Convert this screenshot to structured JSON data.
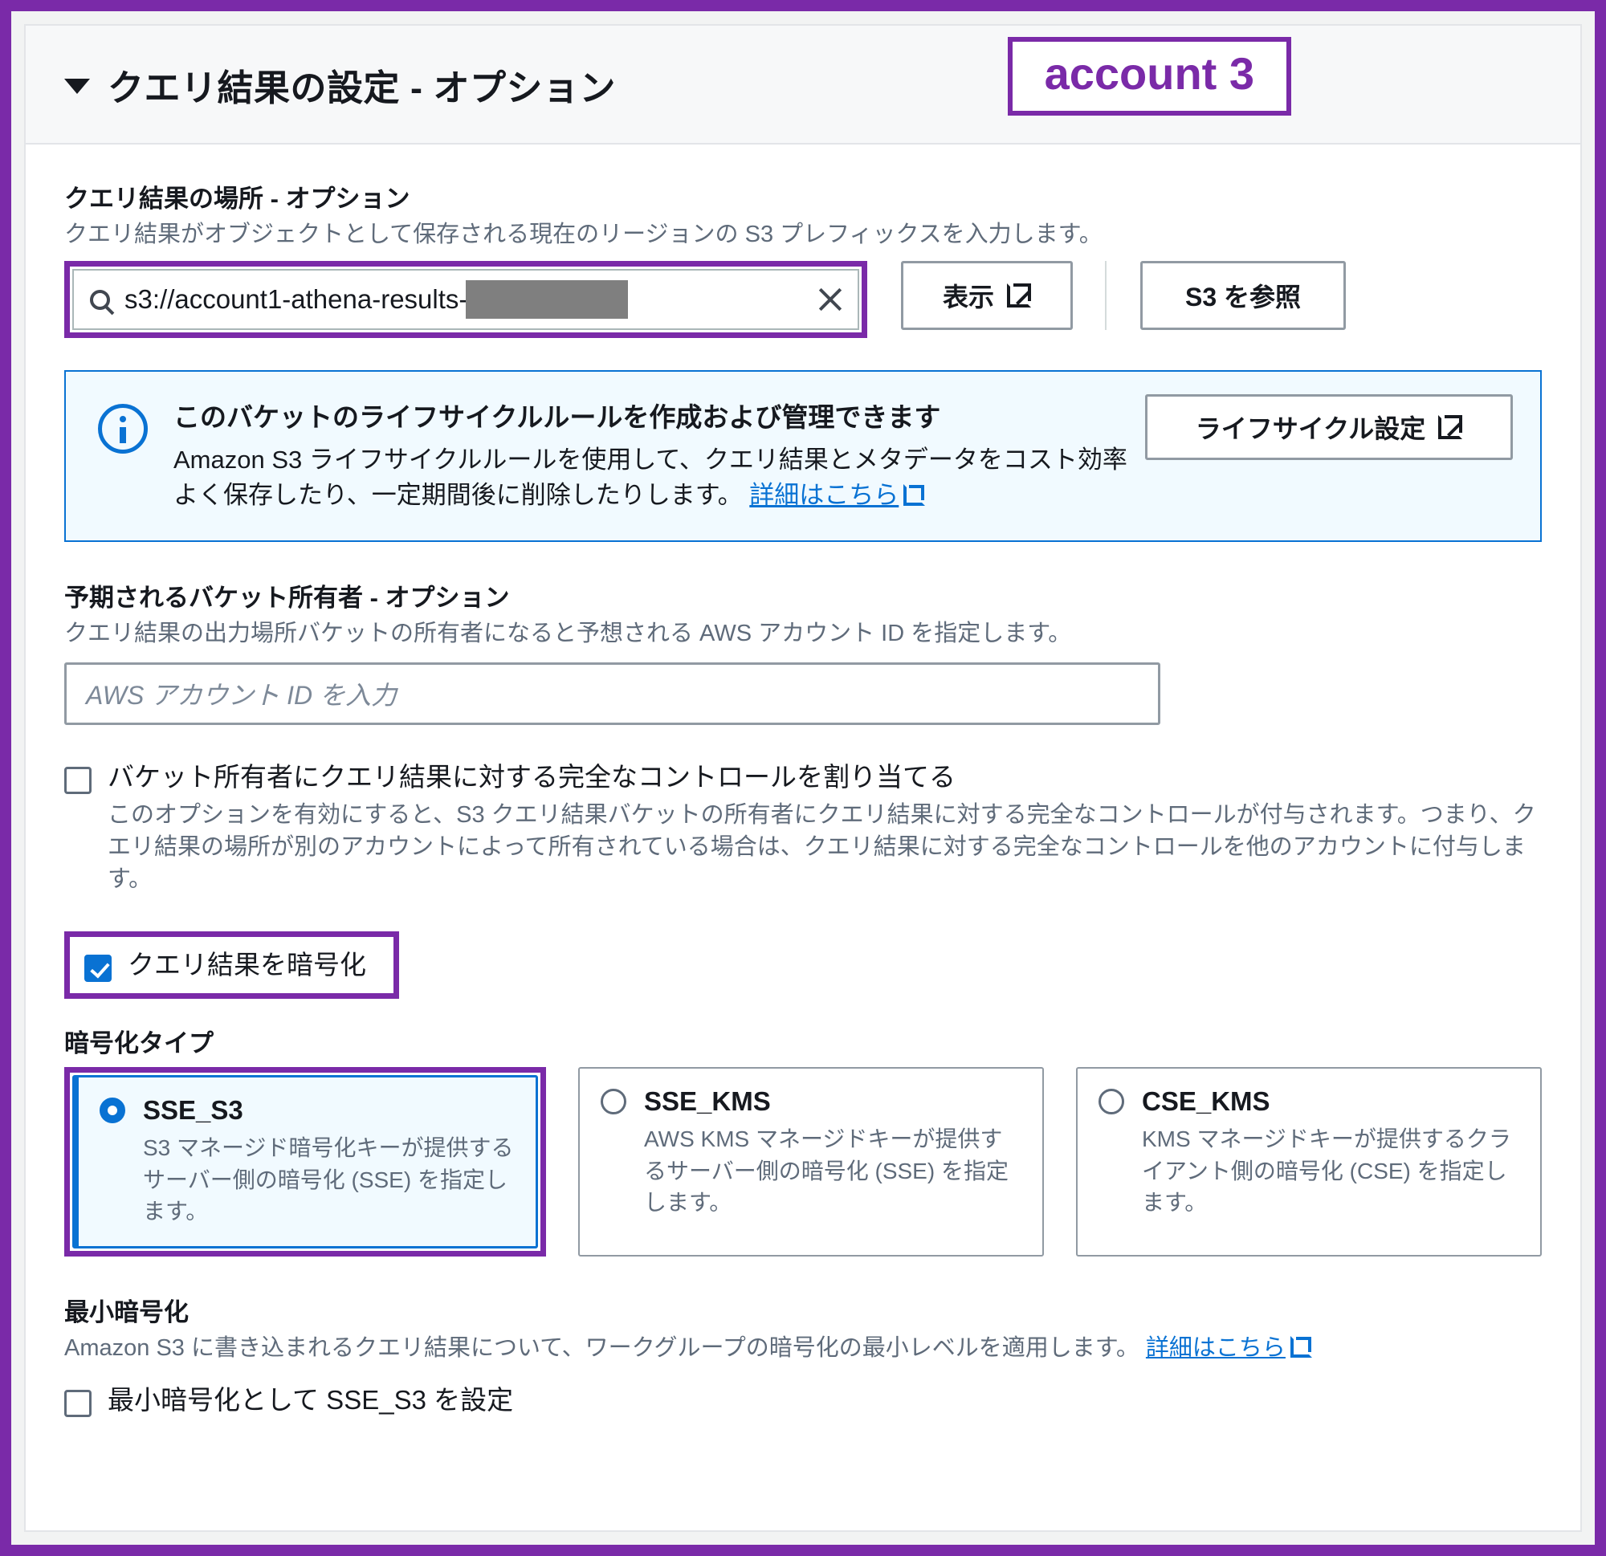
{
  "colors": {
    "highlight_purple": "#7a2aa8",
    "link_blue": "#0972d3",
    "info_bg": "#f1faff",
    "redaction_gray": "#7f7f7f"
  },
  "annotation": {
    "account_badge": "account 3"
  },
  "panel": {
    "title": "クエリ結果の設定 - オプション",
    "caret": "caret-down-icon"
  },
  "query_location": {
    "label": "クエリ結果の場所 - オプション",
    "description": "クエリ結果がオブジェクトとして保存される現在のリージョンの S3 プレフィックスを入力します。",
    "input_value": "s3://account1-athena-results-",
    "input_redacted": true,
    "search_icon": "search-icon",
    "clear_icon": "close-icon",
    "view_button": "表示",
    "browse_button": "S3 を参照"
  },
  "lifecycle_alert": {
    "icon": "info-icon",
    "title": "このバケットのライフサイクルルールを作成および管理できます",
    "body_part1": "Amazon S3 ライフサイクルルールを使用して、クエリ結果とメタデータをコスト効率よく保存したり、一定期間後に削除したりします。",
    "link_text": "詳細はこちら",
    "button": "ライフサイクル設定"
  },
  "expected_owner": {
    "label": "予期されるバケット所有者 - オプション",
    "description": "クエリ結果の出力場所バケットの所有者になると予想される AWS アカウント ID を指定します。",
    "placeholder": "AWS アカウント ID を入力",
    "value": ""
  },
  "full_control": {
    "checked": false,
    "label": "バケット所有者にクエリ結果に対する完全なコントロールを割り当てる",
    "help": "このオプションを有効にすると、S3 クエリ結果バケットの所有者にクエリ結果に対する完全なコントロールが付与されます。つまり、クエリ結果の場所が別のアカウントによって所有されている場合は、クエリ結果に対する完全なコントロールを他のアカウントに付与します。"
  },
  "encrypt_results": {
    "checked": true,
    "label": "クエリ結果を暗号化",
    "highlighted": true
  },
  "encryption_type": {
    "label": "暗号化タイプ",
    "selected": "SSE_S3",
    "options": [
      {
        "id": "SSE_S3",
        "title": "SSE_S3",
        "description": "S3 マネージド暗号化キーが提供するサーバー側の暗号化 (SSE) を指定します。",
        "selected": true,
        "highlighted": true
      },
      {
        "id": "SSE_KMS",
        "title": "SSE_KMS",
        "description": "AWS KMS マネージドキーが提供するサーバー側の暗号化 (SSE) を指定します。",
        "selected": false,
        "highlighted": false
      },
      {
        "id": "CSE_KMS",
        "title": "CSE_KMS",
        "description": "KMS マネージドキーが提供するクライアント側の暗号化 (CSE) を指定します。",
        "selected": false,
        "highlighted": false
      }
    ]
  },
  "minimum_encryption": {
    "label": "最小暗号化",
    "description": "Amazon S3 に書き込まれるクエリ結果について、ワークグループの暗号化の最小レベルを適用します。",
    "link_text": "詳細はこちら",
    "checkbox_label": "最小暗号化として SSE_S3 を設定",
    "checked": false
  }
}
